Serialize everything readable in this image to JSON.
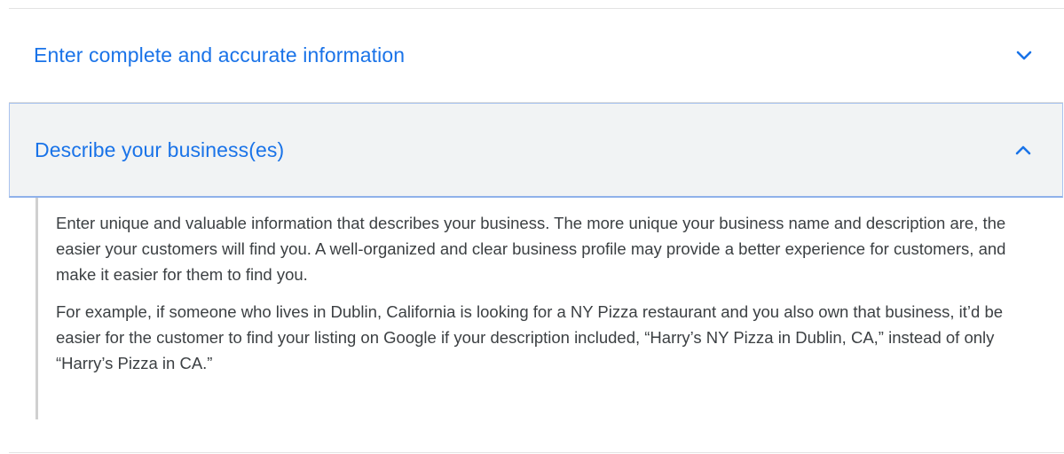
{
  "accordion": {
    "items": [
      {
        "title": "Enter complete and accurate information",
        "state": "collapsed",
        "icon": "chevron-down-icon"
      },
      {
        "title": "Describe your business(es)",
        "state": "expanded",
        "icon": "chevron-up-icon",
        "paragraphs": [
          "Enter unique and valuable information that describes your business. The more unique your business name and description are, the easier your customers will find you. A well-organized and clear business profile may provide a better experience for customers, and make it easier for them to find you.",
          "For example, if someone who lives in Dublin, California is looking for a NY Pizza restaurant and you also own that business, it’d be easier for the customer to find your listing on Google if your description included, “Harry’s NY Pizza in Dublin, CA,” instead of only “Harry’s Pizza in CA.”"
        ]
      }
    ]
  },
  "colors": {
    "accent": "#1a73e8",
    "expanded_header_bg": "#f1f3f4",
    "body_text": "#3c4043"
  }
}
